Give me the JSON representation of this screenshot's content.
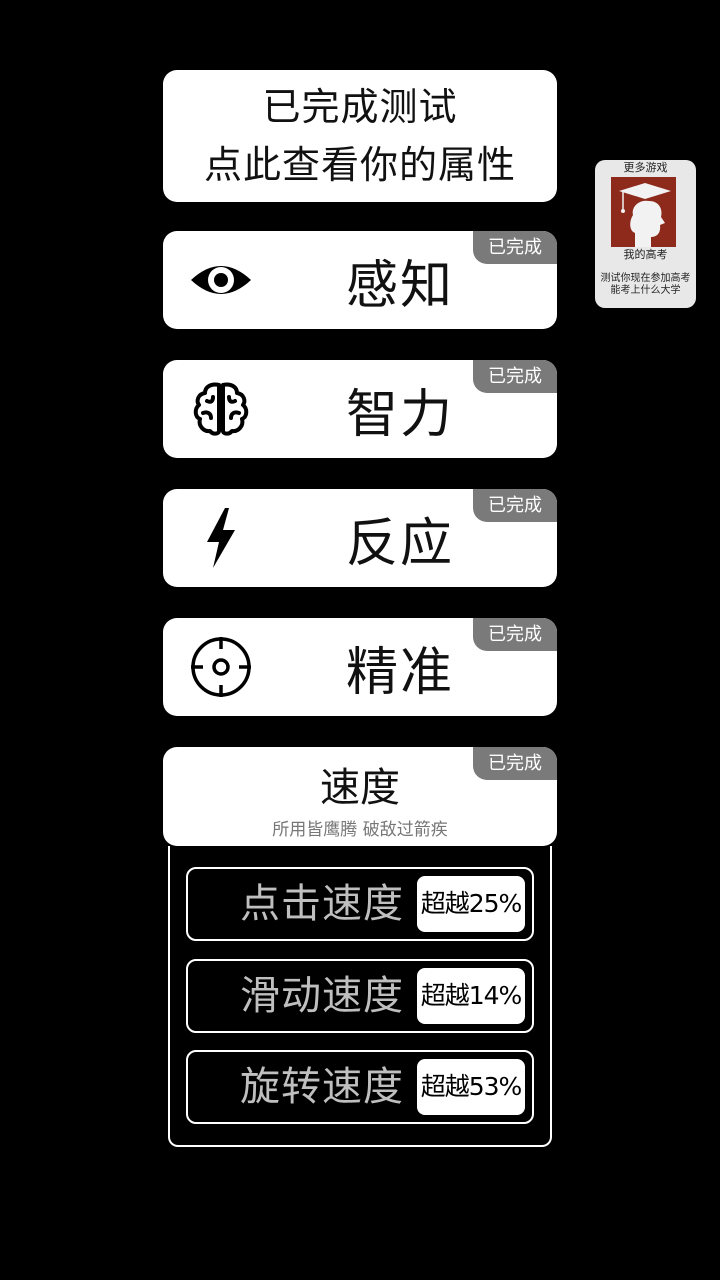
{
  "header": {
    "line1": "已完成测试",
    "line2": "点此查看你的属性"
  },
  "categories": [
    {
      "label": "感知",
      "badge": "已完成",
      "icon": "eye-icon"
    },
    {
      "label": "智力",
      "badge": "已完成",
      "icon": "brain-icon"
    },
    {
      "label": "反应",
      "badge": "已完成",
      "icon": "lightning-icon"
    },
    {
      "label": "精准",
      "badge": "已完成",
      "icon": "crosshair-icon"
    }
  ],
  "speed": {
    "label": "速度",
    "badge": "已完成",
    "subtitle": "所用皆鹰腾 破敌过箭疾",
    "stats": [
      {
        "name": "点击速度",
        "value": "超越25%"
      },
      {
        "name": "滑动速度",
        "value": "超越14%"
      },
      {
        "name": "旋转速度",
        "value": "超越53%"
      }
    ]
  },
  "promo": {
    "more_label": "更多游戏",
    "game_name": "我的高考",
    "description": "测试你现在参加高考能考上什么大学",
    "thumb_icon": "graduate-head-icon"
  },
  "colors": {
    "background": "#000000",
    "card": "#ffffff",
    "badge": "#7a7a7a",
    "promo_thumb": "#8e2a1c"
  }
}
